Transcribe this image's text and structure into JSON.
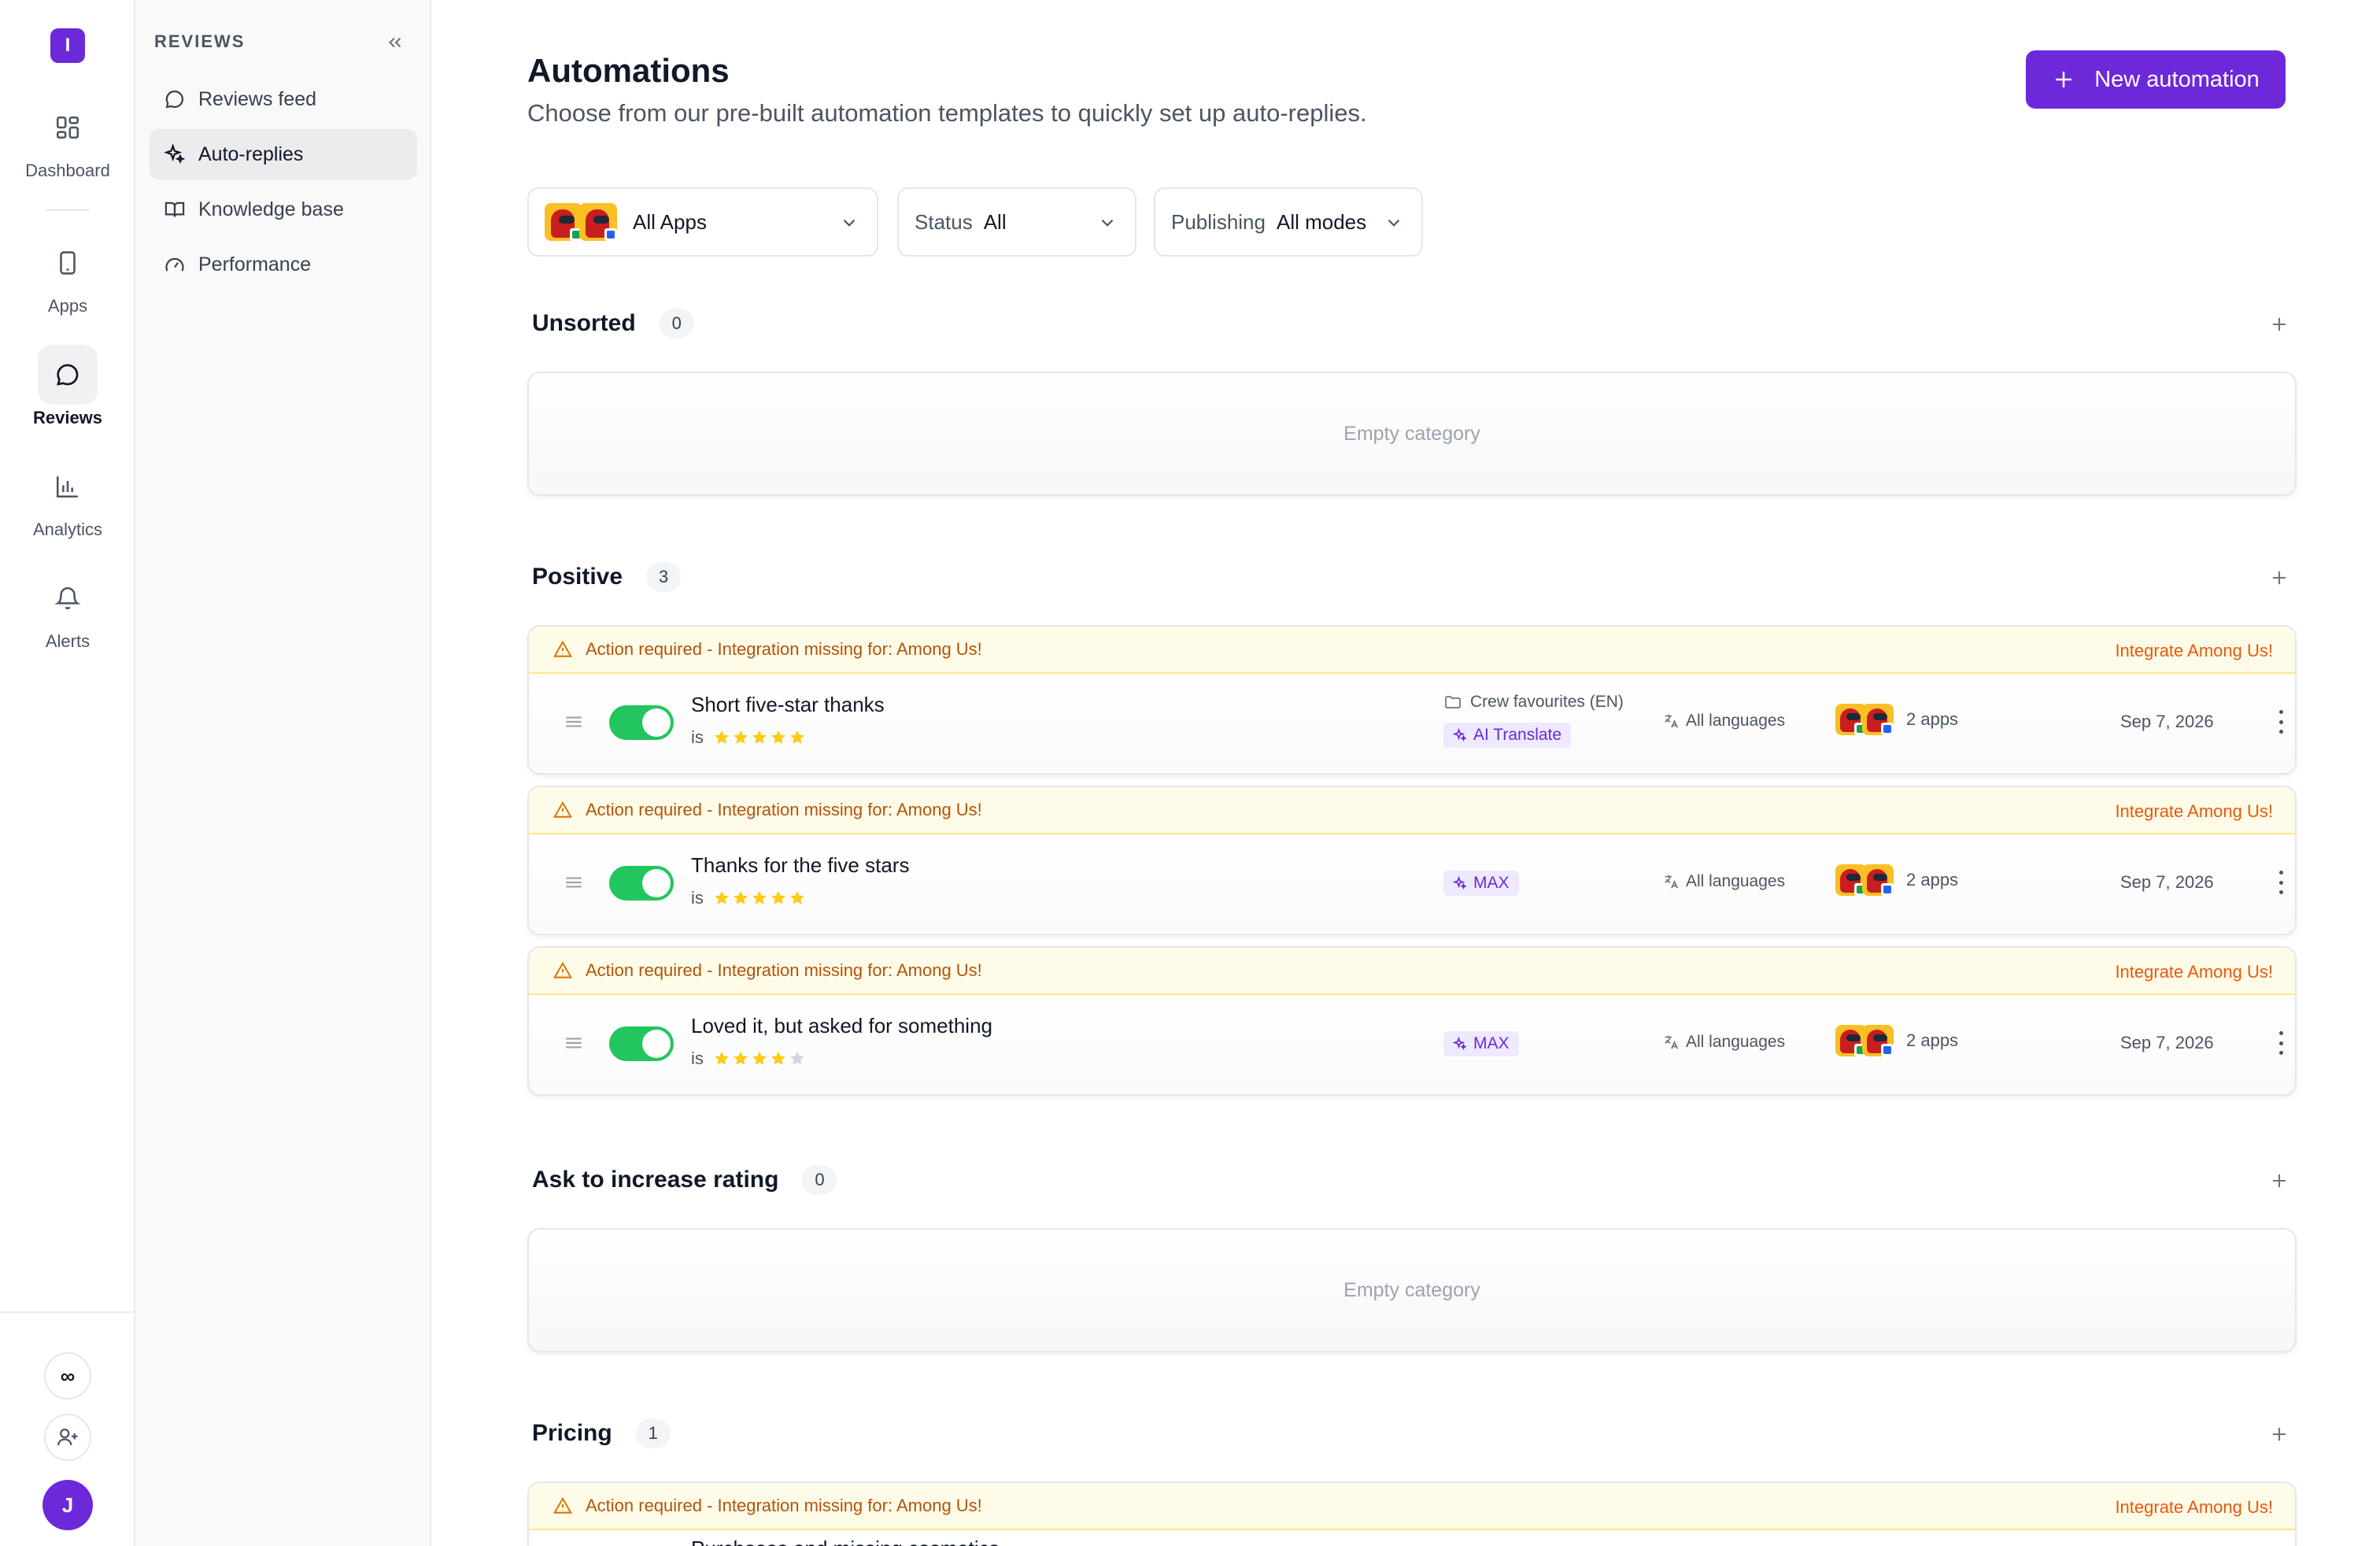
{
  "rail": {
    "logo_letter": "I",
    "items": [
      {
        "label": "Dashboard",
        "icon": "grid-icon"
      },
      {
        "label": "Apps",
        "icon": "phone-icon"
      },
      {
        "label": "Reviews",
        "icon": "chat-bubble-icon"
      },
      {
        "label": "Analytics",
        "icon": "bar-chart-icon"
      },
      {
        "label": "Alerts",
        "icon": "bell-icon"
      }
    ],
    "infinity_label": "∞",
    "avatar_letter": "J"
  },
  "sidebar": {
    "heading": "REVIEWS",
    "items": [
      {
        "label": "Reviews feed",
        "icon": "chat-bubble-icon"
      },
      {
        "label": "Auto-replies",
        "icon": "sparkle-icon"
      },
      {
        "label": "Knowledge base",
        "icon": "book-icon"
      },
      {
        "label": "Performance",
        "icon": "gauge-icon"
      }
    ]
  },
  "header": {
    "title": "Automations",
    "subtitle": "Choose from our pre-built automation templates to quickly set up auto-replies.",
    "new_button": "New automation"
  },
  "filters": {
    "apps": "All Apps",
    "status_label": "Status",
    "status_value": "All",
    "publishing_label": "Publishing",
    "publishing_value": "All modes"
  },
  "empty_label": "Empty category",
  "warning": {
    "text": "Action required - Integration missing for: Among Us!",
    "link": "Integrate Among Us!"
  },
  "sections": [
    {
      "title": "Unsorted",
      "count": "0"
    },
    {
      "title": "Positive",
      "count": "3"
    },
    {
      "title": "Ask to increase rating",
      "count": "0"
    },
    {
      "title": "Pricing",
      "count": "1"
    }
  ],
  "automations": [
    {
      "name": "Short five-star thanks",
      "condition": "is",
      "rating": 5,
      "knowledge_base": "Crew favourites (EN)",
      "tag": "AI Translate",
      "languages": "All languages",
      "apps": "2 apps",
      "date": "Sep 7, 2026"
    },
    {
      "name": "Thanks for the five stars",
      "condition": "is",
      "rating": 5,
      "tag": "MAX",
      "languages": "All languages",
      "apps": "2 apps",
      "date": "Sep 7, 2026"
    },
    {
      "name": "Loved it, but asked for something",
      "condition": "is",
      "rating": 4,
      "tag": "MAX",
      "languages": "All languages",
      "apps": "2 apps",
      "date": "Sep 7, 2026"
    }
  ],
  "pricing_preview": {
    "name": "Purchases and missing cosmetics"
  },
  "colors": {
    "accent": "#6d28d9",
    "toggle_on": "#22c55e",
    "star": "#facc15",
    "star_off": "#d1d5db",
    "warning_bg": "#fefce8",
    "warning_text": "#b45309",
    "warning_link": "#ea580c"
  }
}
